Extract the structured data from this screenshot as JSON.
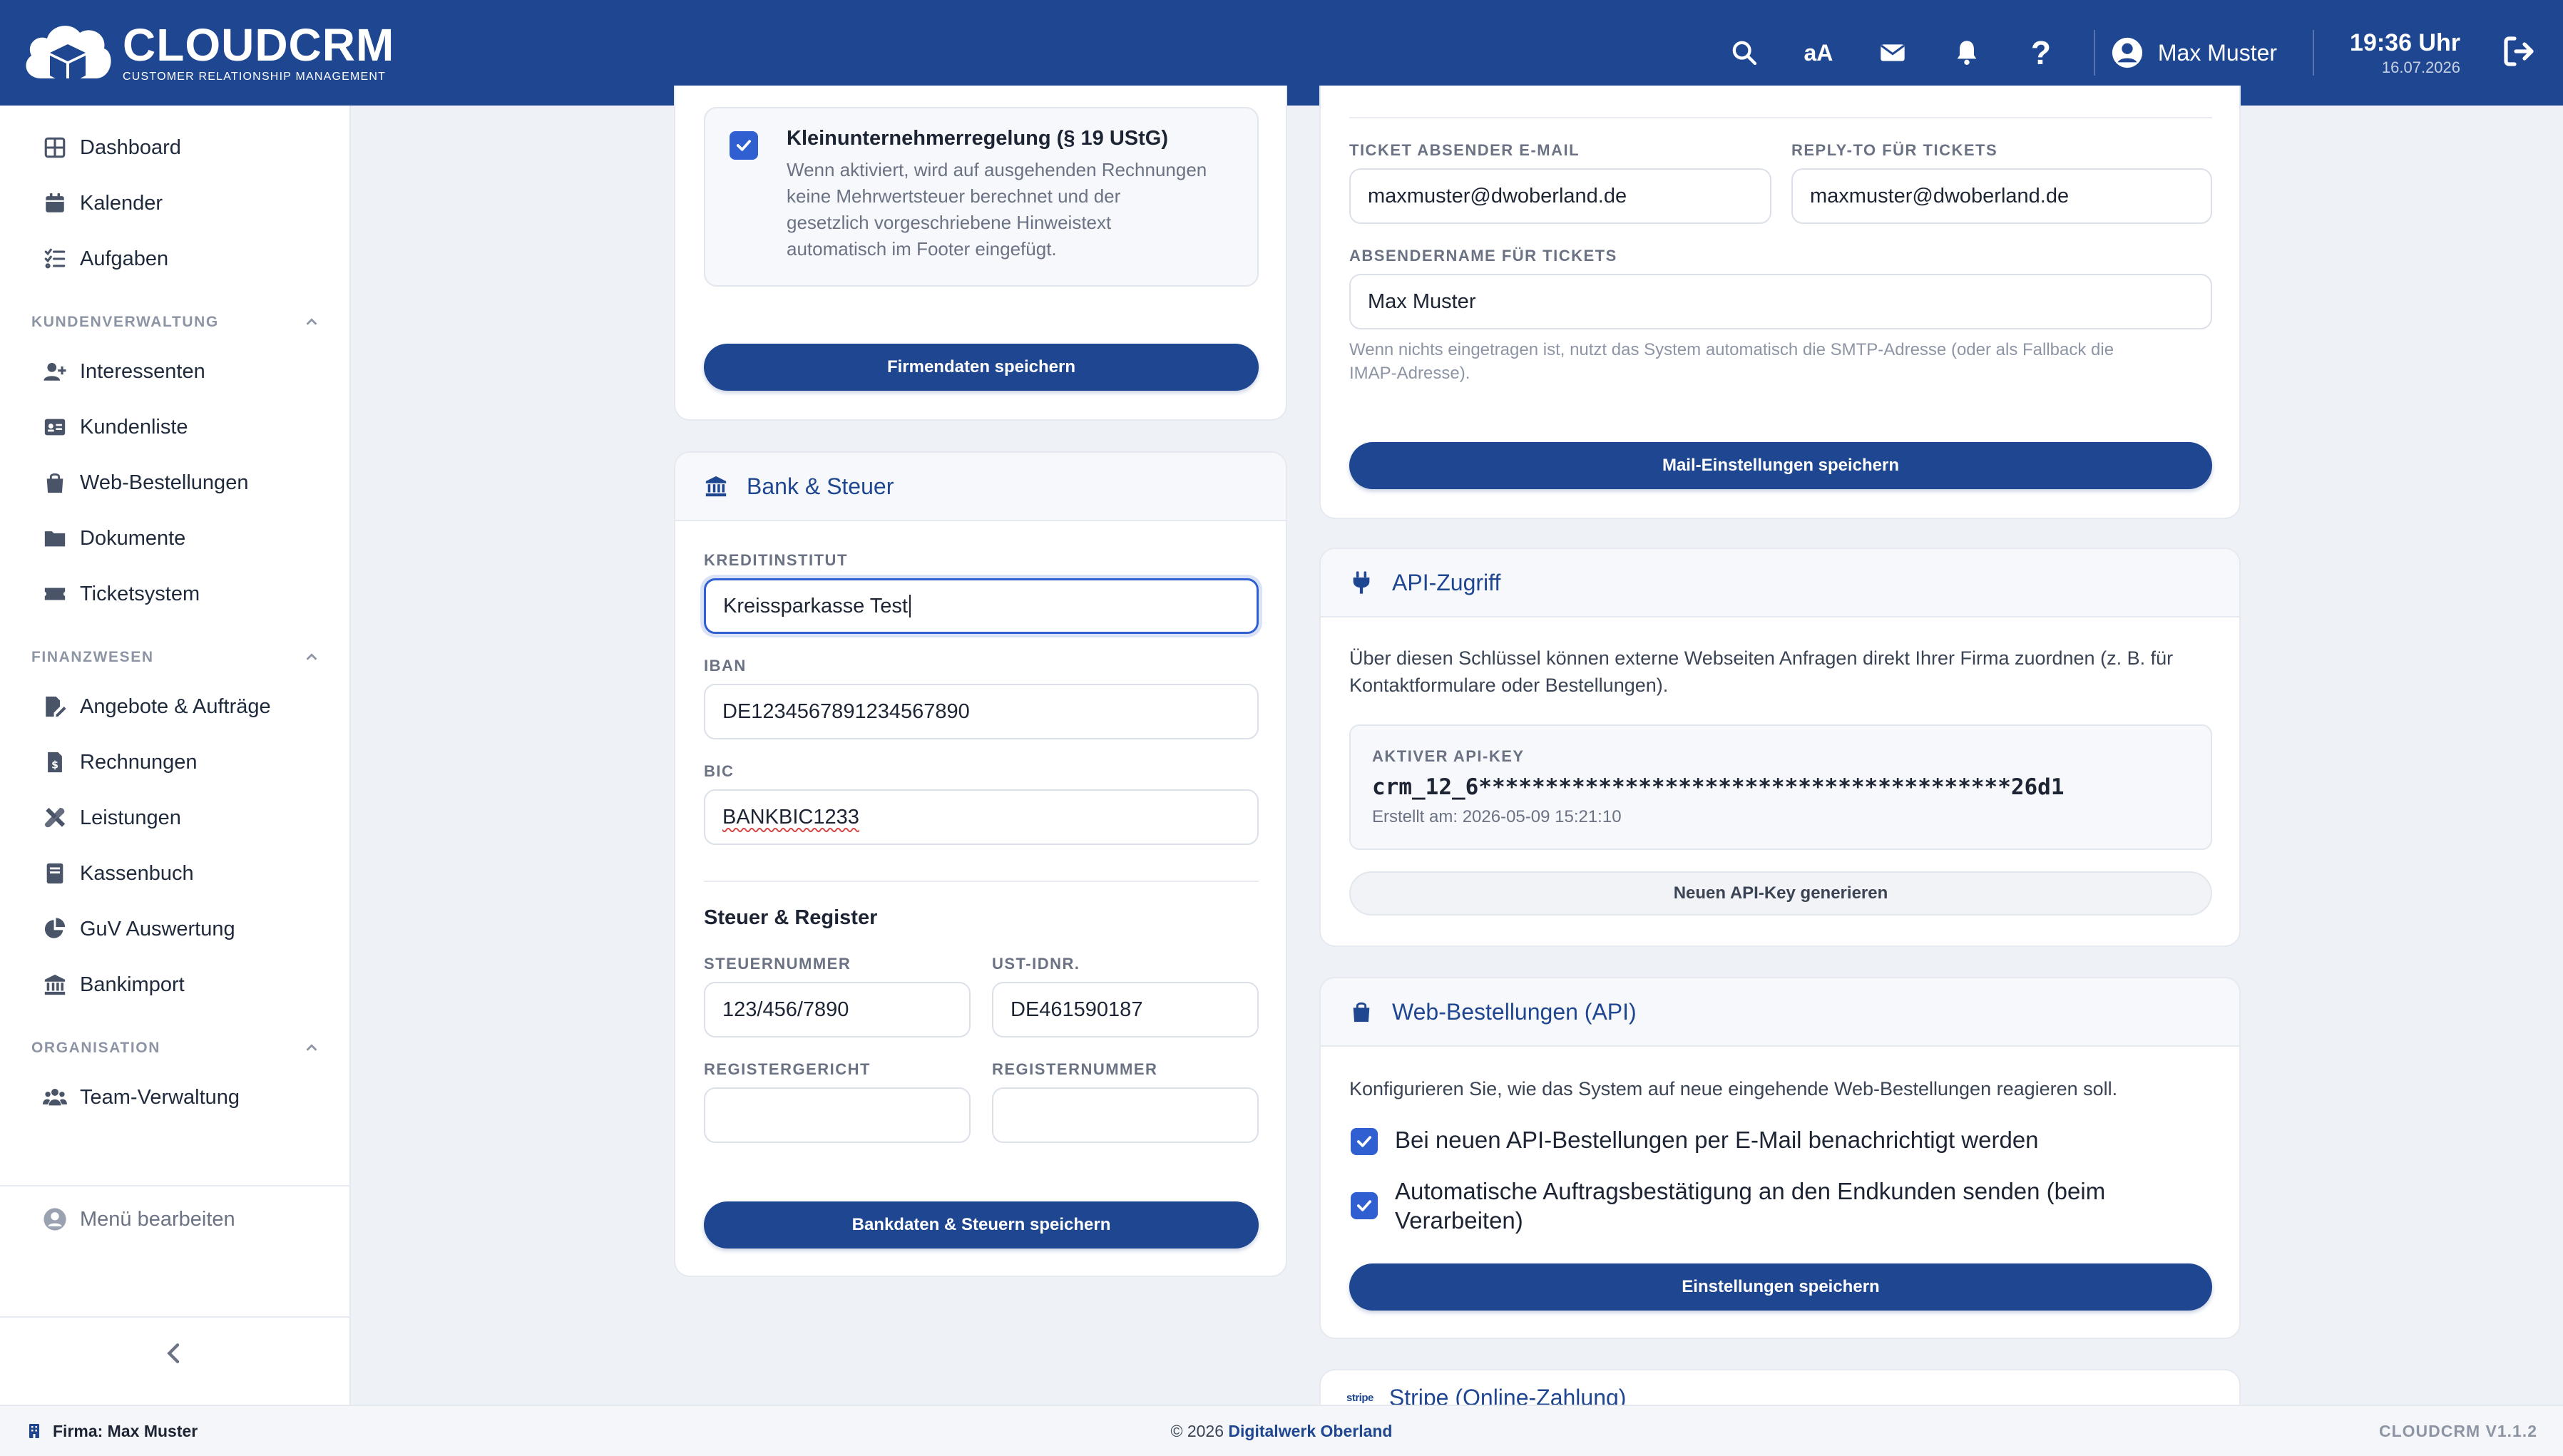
{
  "app": {
    "logo_title": "CLOUDCRM",
    "logo_subtitle": "CUSTOMER RELATIONSHIP MANAGEMENT",
    "font_toggle": "aA",
    "help": "?",
    "user_name": "Max Muster",
    "time": "19:36 Uhr",
    "date": "16.07.2026"
  },
  "sidebar": {
    "items_top": [
      {
        "label": "Dashboard",
        "icon": "dashboard-icon"
      },
      {
        "label": "Kalender",
        "icon": "calendar-icon"
      },
      {
        "label": "Aufgaben",
        "icon": "tasks-icon"
      }
    ],
    "sections": [
      {
        "title": "KUNDENVERWALTUNG",
        "items": [
          {
            "label": "Interessenten",
            "icon": "user-plus-icon"
          },
          {
            "label": "Kundenliste",
            "icon": "id-card-icon"
          },
          {
            "label": "Web-Bestellungen",
            "icon": "shopping-bag-icon"
          },
          {
            "label": "Dokumente",
            "icon": "folder-icon"
          },
          {
            "label": "Ticketsystem",
            "icon": "ticket-icon"
          }
        ]
      },
      {
        "title": "FINANZWESEN",
        "items": [
          {
            "label": "Angebote & Aufträge",
            "icon": "file-signature-icon"
          },
          {
            "label": "Rechnungen",
            "icon": "invoice-icon"
          },
          {
            "label": "Leistungen",
            "icon": "tools-icon"
          },
          {
            "label": "Kassenbuch",
            "icon": "book-icon"
          },
          {
            "label": "GuV Auswertung",
            "icon": "pie-chart-icon"
          },
          {
            "label": "Bankimport",
            "icon": "bank-icon"
          }
        ]
      },
      {
        "title": "ORGANISATION",
        "items": [
          {
            "label": "Team-Verwaltung",
            "icon": "users-icon"
          }
        ]
      }
    ],
    "menu_edit": "Menü bearbeiten"
  },
  "firm_card": {
    "checkbox_title": "Kleinunternehmerregelung (§ 19 UStG)",
    "checkbox_desc_lines": [
      "Wenn aktiviert, wird auf ausgehenden Rechnungen",
      "keine Mehrwertsteuer berechnet und der",
      "gesetzlich vorgeschriebene Hinweistext",
      "automatisch im Footer eingefügt."
    ],
    "save_button": "Firmendaten speichern"
  },
  "bank_card": {
    "title": "Bank & Steuer",
    "kreditinstitut_label": "KREDITINSTITUT",
    "kreditinstitut_value": "Kreissparkasse Test",
    "iban_label": "IBAN",
    "iban_value": "DE1234567891234567890",
    "bic_label": "BIC",
    "bic_value": "BANKBIC1233",
    "tax_heading": "Steuer & Register",
    "steuernummer_label": "STEUERNUMMER",
    "steuernummer_value": "123/456/7890",
    "ustid_label": "UST-IDNR.",
    "ustid_value": "DE461590187",
    "registergericht_label": "REGISTERGERICHT",
    "registergericht_value": "",
    "registernummer_label": "REGISTERNUMMER",
    "registernummer_value": "",
    "save_button": "Bankdaten & Steuern speichern"
  },
  "mail_card": {
    "sender_label": "TICKET ABSENDER E-MAIL",
    "sender_value": "maxmuster@dwoberland.de",
    "replyto_label": "REPLY-TO FÜR TICKETS",
    "replyto_value": "maxmuster@dwoberland.de",
    "name_label": "ABSENDERNAME FÜR TICKETS",
    "name_value": "Max Muster",
    "hint_lines": [
      "Wenn nichts eingetragen ist, nutzt das System automatisch die SMTP-Adresse (oder als Fallback die",
      "IMAP-Adresse)."
    ],
    "save_button": "Mail-Einstellungen speichern"
  },
  "api_card": {
    "title": "API-Zugriff",
    "desc_lines": [
      "Über diesen Schlüssel können externe Webseiten Anfragen direkt Ihrer Firma zuordnen (z. B. für",
      "Kontaktformulare oder Bestellungen)."
    ],
    "key_label": "AKTIVER API-KEY",
    "key_value": "crm_12_6****************************************26d1",
    "created": "Erstellt am: 2026-05-09 15:21:10",
    "regen_button": "Neuen API-Key generieren"
  },
  "web_card": {
    "title": "Web-Bestellungen (API)",
    "desc": "Konfigurieren Sie, wie das System auf neue eingehende Web-Bestellungen reagieren soll.",
    "option1": "Bei neuen API-Bestellungen per E-Mail benachrichtigt werden",
    "option1_checked": true,
    "option2_line1": "Automatische Auftragsbestätigung an den Endkunden senden (beim",
    "option2_line2": "Verarbeiten)",
    "option2_checked": true,
    "save_button": "Einstellungen speichern"
  },
  "stripe_card": {
    "brand": "stripe",
    "title": "Stripe (Online-Zahlung)"
  },
  "footer": {
    "firm": "Firma: Max Muster",
    "copyright_prefix": "© 2026 ",
    "copyright_company": "Digitalwerk Oberland",
    "version": "CLOUDCRM V1.1.2"
  }
}
